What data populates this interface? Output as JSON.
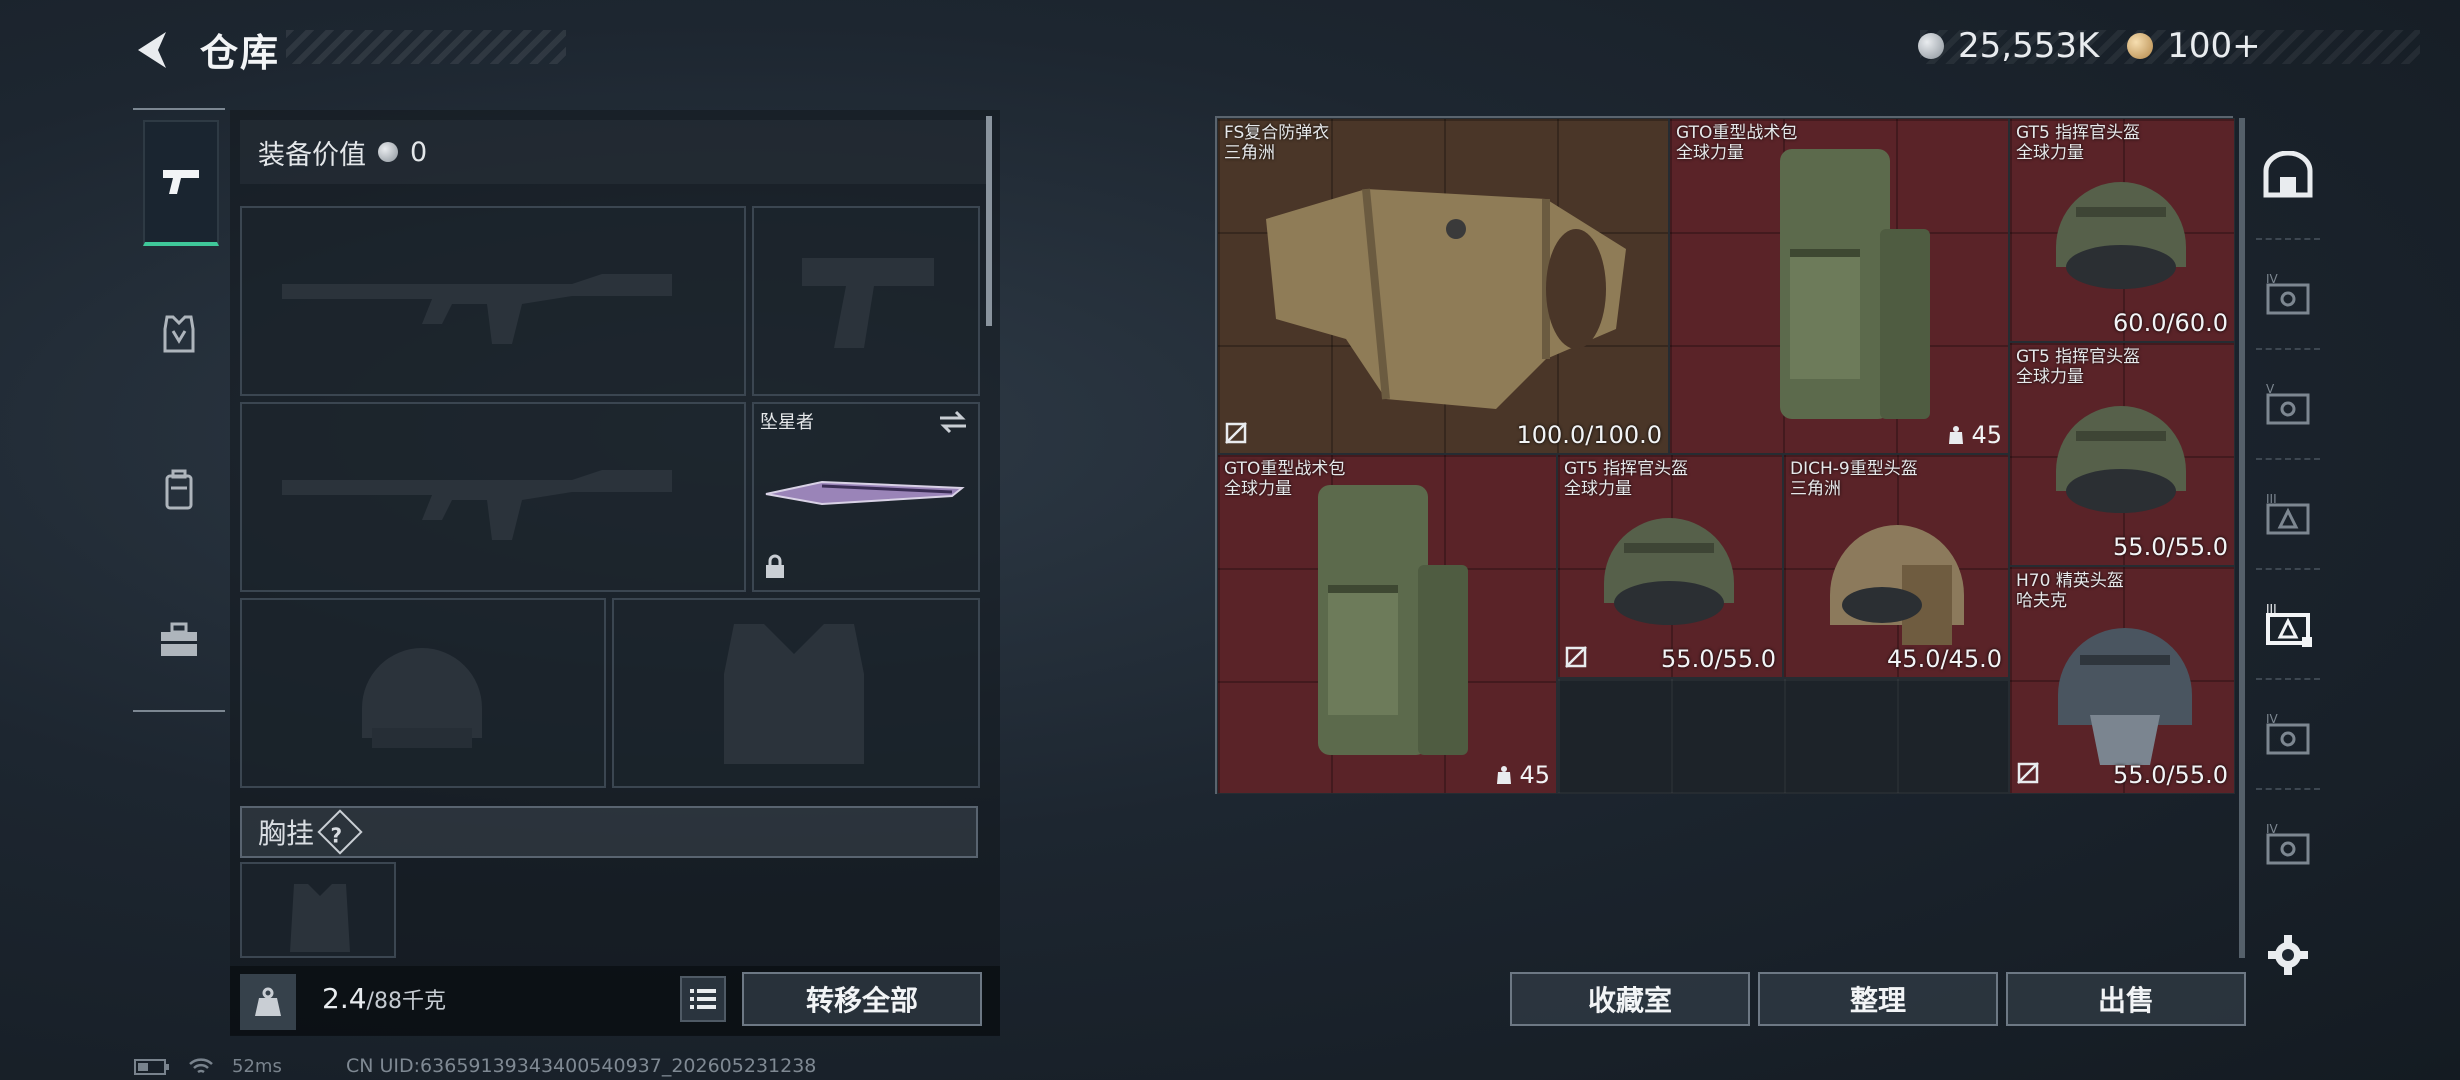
{
  "header": {
    "title": "仓库",
    "currency_silver": "25,553K",
    "currency_gold": "100+"
  },
  "loadout": {
    "equip_value_label": "装备价值",
    "equip_value": "0",
    "melee_name": "坠星者",
    "chest_rig_label": "胸挂",
    "chest_rig_help": "?"
  },
  "weight": {
    "current": "2.4",
    "max_unit": "/88千克"
  },
  "buttons": {
    "transfer_all": "转移全部",
    "collection": "收藏室",
    "organize": "整理",
    "sell": "出售"
  },
  "stash_items": [
    {
      "name_line1": "FS复合防弹衣",
      "name_line2": "三角洲",
      "durability": "100.0/100.0",
      "bg": "brown"
    },
    {
      "name_line1": "GTO重型战术包",
      "name_line2": "全球力量",
      "capacity": "45",
      "bg": "red"
    },
    {
      "name_line1": "GT5 指挥官头盔",
      "name_line2": "全球力量",
      "durability": "60.0/60.0",
      "bg": "red"
    },
    {
      "name_line1": "GT5 指挥官头盔",
      "name_line2": "全球力量",
      "durability": "55.0/55.0",
      "bg": "red"
    },
    {
      "name_line1": "GTO重型战术包",
      "name_line2": "全球力量",
      "capacity": "45",
      "bg": "red"
    },
    {
      "name_line1": "GT5 指挥官头盔",
      "name_line2": "全球力量",
      "durability": "55.0/55.0",
      "bg": "red"
    },
    {
      "name_line1": "DICH-9重型头盔",
      "name_line2": "三角洲",
      "durability": "45.0/45.0",
      "bg": "red"
    },
    {
      "name_line1": "H70 精英头盔",
      "name_line2": "哈夫克",
      "durability": "55.0/55.0",
      "bg": "red"
    }
  ],
  "status": {
    "ping": "52ms",
    "uid": "CN UID:636591393434005409​37_20260523123​8"
  }
}
